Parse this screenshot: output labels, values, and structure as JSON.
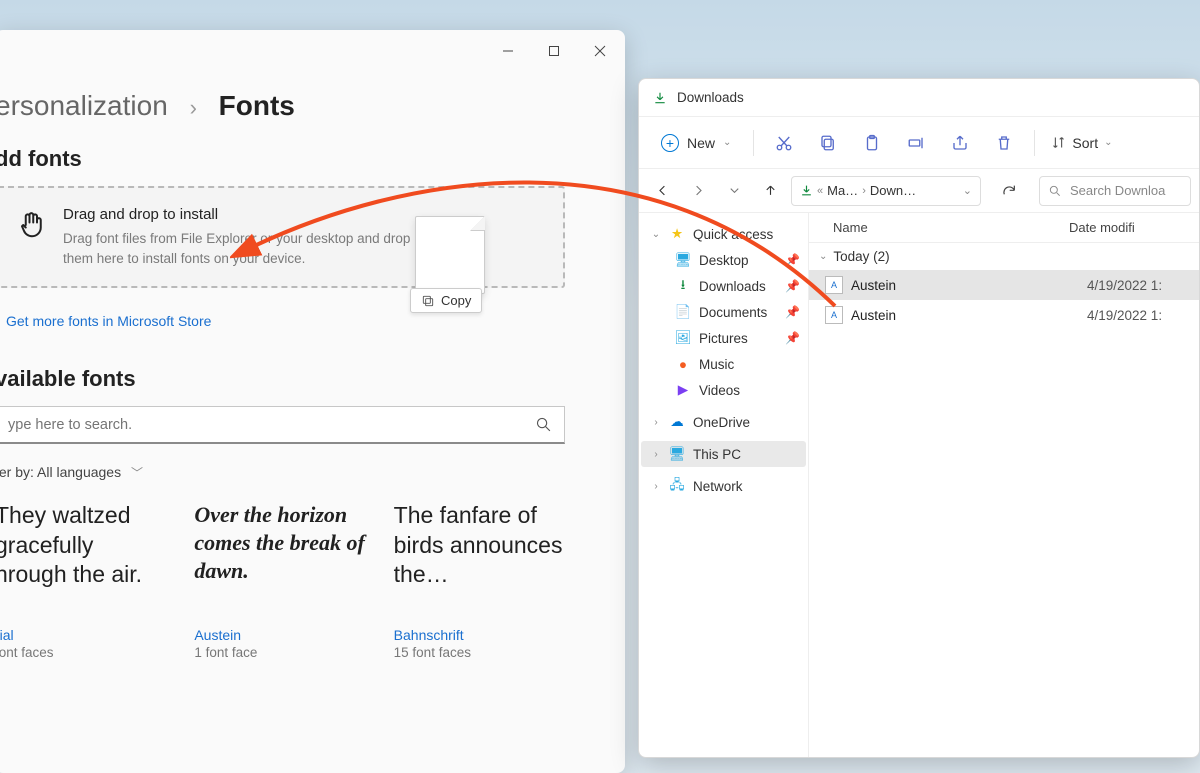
{
  "settings": {
    "breadcrumb_parent": "ersonalization",
    "breadcrumb_current": "Fonts",
    "add_fonts_header": "dd fonts",
    "dropzone_title": "Drag and drop to install",
    "dropzone_desc": "Drag font files from File Explorer or your desktop and drop them here to install fonts on your device.",
    "copy_badge": "Copy",
    "store_link": "Get more fonts in Microsoft Store",
    "available_header": "vailable fonts",
    "search_placeholder": "ype here to search.",
    "filter_label": "ter by:",
    "filter_value": "All languages",
    "fonts": [
      {
        "sample": "They waltzed gracefully hrough the air.",
        "name": "rial",
        "faces": "font faces"
      },
      {
        "sample": "Over the horizon comes the break of dawn.",
        "name": "Austein",
        "faces": "1 font face"
      },
      {
        "sample": "The fanfare of birds announces the…",
        "name": "Bahnschrift",
        "faces": "15 font faces"
      }
    ]
  },
  "explorer": {
    "title": "Downloads",
    "new_label": "New",
    "sort_label": "Sort",
    "path_seg1": "Ma…",
    "path_seg2": "Down…",
    "search_placeholder": "Search Downloa",
    "col_name": "Name",
    "col_date": "Date modifi",
    "group_header": "Today (2)",
    "nav": {
      "quick": "Quick access",
      "desktop": "Desktop",
      "downloads": "Downloads",
      "documents": "Documents",
      "pictures": "Pictures",
      "music": "Music",
      "videos": "Videos",
      "onedrive": "OneDrive",
      "thispc": "This PC",
      "network": "Network"
    },
    "files": [
      {
        "name": "Austein",
        "date": "4/19/2022 1:"
      },
      {
        "name": "Austein",
        "date": "4/19/2022 1:"
      }
    ]
  }
}
